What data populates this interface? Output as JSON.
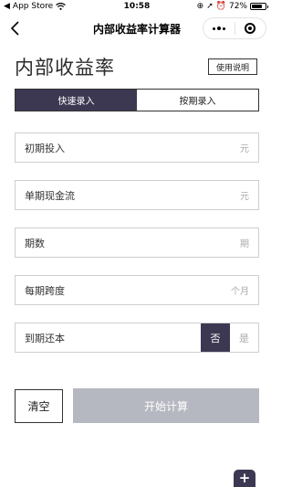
{
  "status_bar": {
    "carrier": "App Store",
    "time": "10:58",
    "battery": "72%"
  },
  "nav": {
    "title": "内部收益率计算器"
  },
  "header": {
    "title": "内部收益率",
    "help_label": "使用说明"
  },
  "tabs": [
    {
      "label": "快速录入",
      "active": true
    },
    {
      "label": "按期录入",
      "active": false
    }
  ],
  "fields": {
    "initial_investment": {
      "label": "初期投入",
      "unit": "元"
    },
    "cash_flow": {
      "label": "单期现金流",
      "unit": "元"
    },
    "periods": {
      "label": "期数",
      "unit": "期"
    },
    "period_span": {
      "label": "每期跨度",
      "unit": "个月"
    },
    "principal_return": {
      "label": "到期还本",
      "option_no": "否",
      "option_yes": "是",
      "selected": "否"
    }
  },
  "actions": {
    "clear_label": "清空",
    "start_label": "开始计算"
  },
  "colors": {
    "accent": "#3d3852",
    "disabled_button": "#b6b8c1",
    "border": "#cfcfcf"
  }
}
